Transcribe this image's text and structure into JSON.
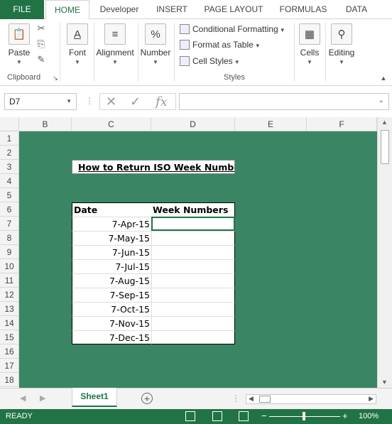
{
  "tabs": [
    "FILE",
    "HOME",
    "Developer",
    "INSERT",
    "PAGE LAYOUT",
    "FORMULAS",
    "DATA"
  ],
  "ribbon": {
    "clipboard": {
      "paste": "Paste",
      "group_label": "Clipboard"
    },
    "font": "Font",
    "alignment": "Alignment",
    "number": "Number",
    "styles": {
      "conditional_formatting": "Conditional Formatting",
      "format_as_table": "Format as Table",
      "cell_styles": "Cell Styles",
      "group_label": "Styles"
    },
    "cells": "Cells",
    "editing": "Editing"
  },
  "formula_bar": {
    "name_box": "D7",
    "fx": "fx",
    "content": ""
  },
  "columns": [
    "B",
    "C",
    "D",
    "E",
    "F"
  ],
  "rows": [
    "1",
    "2",
    "3",
    "4",
    "5",
    "6",
    "7",
    "8",
    "9",
    "10",
    "11",
    "12",
    "13",
    "14",
    "15",
    "16",
    "17",
    "18"
  ],
  "sheet": {
    "title": "How to Return ISO Week Numbers",
    "table_headers": {
      "date": "Date",
      "week": "Week Numbers"
    },
    "dates": [
      "7-Apr-15",
      "7-May-15",
      "7-Jun-15",
      "7-Jul-15",
      "7-Aug-15",
      "7-Sep-15",
      "7-Oct-15",
      "7-Nov-15",
      "7-Dec-15"
    ],
    "fill_color": "#3a8664"
  },
  "sheet_tabs": [
    "Sheet1"
  ],
  "status": {
    "mode": "READY",
    "zoom": "100%"
  },
  "colors": {
    "excel_green": "#217346"
  }
}
